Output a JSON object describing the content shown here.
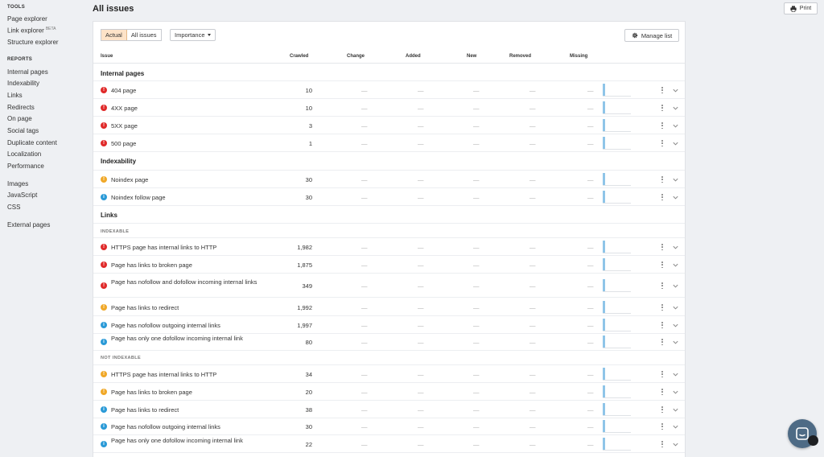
{
  "sidebar": {
    "tools_heading": "TOOLS",
    "page_explorer": "Page explorer",
    "link_explorer": "Link explorer",
    "link_explorer_badge": "BETA",
    "structure_explorer": "Structure explorer",
    "reports_heading": "REPORTS",
    "internal_pages": "Internal pages",
    "indexability": "Indexability",
    "links": "Links",
    "redirects": "Redirects",
    "on_page": "On page",
    "social_tags": "Social tags",
    "duplicate_content": "Duplicate content",
    "localization": "Localization",
    "performance": "Performance",
    "images": "Images",
    "javascript": "JavaScript",
    "css": "CSS",
    "external_pages": "External pages"
  },
  "header": {
    "title": "All issues",
    "print_label": "Print"
  },
  "filters": {
    "actual": "Actual",
    "all_issues": "All issues",
    "importance": "Importance",
    "manage_list": "Manage list"
  },
  "columns": {
    "issue": "Issue",
    "crawled": "Crawled",
    "change": "Change",
    "added": "Added",
    "new": "New",
    "removed": "Removed",
    "missing": "Missing"
  },
  "empty_value": "—",
  "colors": {
    "error": "#e02a2a",
    "warning": "#f0a828",
    "notice": "#2a9ad7",
    "active_filter": "#fde3c8"
  },
  "sections": {
    "internal_pages": "Internal pages",
    "indexability": "Indexability",
    "links": "Links",
    "indexable": "INDEXABLE",
    "not_indexable": "NOT INDEXABLE"
  },
  "rows": [
    {
      "severity": "error",
      "icon": "error-icon",
      "name": "404 page",
      "crawled": "10"
    },
    {
      "severity": "error",
      "icon": "error-icon",
      "name": "4XX page",
      "crawled": "10"
    },
    {
      "severity": "error",
      "icon": "error-icon",
      "name": "5XX page",
      "crawled": "3"
    },
    {
      "severity": "error",
      "icon": "error-icon",
      "name": "500 page",
      "crawled": "1"
    },
    {
      "severity": "warning",
      "icon": "warning-icon",
      "name": "Noindex page",
      "crawled": "30"
    },
    {
      "severity": "notice",
      "icon": "notice-icon",
      "name": "Noindex follow page",
      "crawled": "30"
    },
    {
      "severity": "error",
      "icon": "error-icon",
      "name": "HTTPS page has internal links to HTTP",
      "crawled": "1,982"
    },
    {
      "severity": "error",
      "icon": "error-icon",
      "name": "Page has links to broken page",
      "crawled": "1,875"
    },
    {
      "severity": "error",
      "icon": "error-icon",
      "name": "Page has nofollow and dofollow incoming internal links",
      "crawled": "349"
    },
    {
      "severity": "warning",
      "icon": "warning-icon",
      "name": "Page has links to redirect",
      "crawled": "1,992"
    },
    {
      "severity": "notice",
      "icon": "notice-icon",
      "name": "Page has nofollow outgoing internal links",
      "crawled": "1,997"
    },
    {
      "severity": "notice",
      "icon": "notice-icon",
      "name": "Page has only one dofollow incoming internal link",
      "crawled": "80"
    },
    {
      "severity": "warning",
      "icon": "warning-icon",
      "name": "HTTPS page has internal links to HTTP",
      "crawled": "34"
    },
    {
      "severity": "warning",
      "icon": "warning-icon",
      "name": "Page has links to broken page",
      "crawled": "20"
    },
    {
      "severity": "notice",
      "icon": "notice-icon",
      "name": "Page has links to redirect",
      "crawled": "38"
    },
    {
      "severity": "notice",
      "icon": "notice-icon",
      "name": "Page has nofollow outgoing internal links",
      "crawled": "30"
    },
    {
      "severity": "notice",
      "icon": "notice-icon",
      "name": "Page has only one dofollow incoming internal link",
      "crawled": "22"
    }
  ]
}
